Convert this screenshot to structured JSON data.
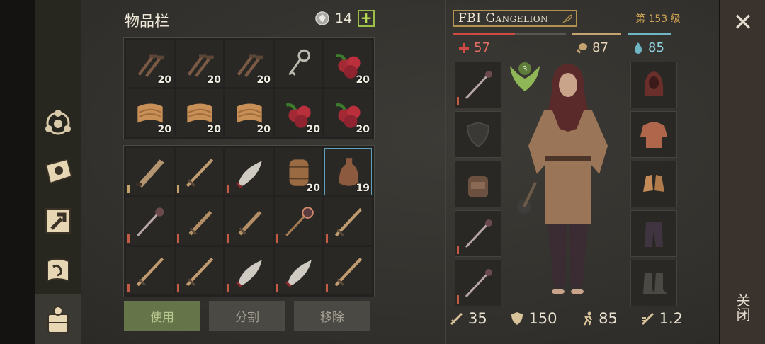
{
  "inventory": {
    "title": "物品栏",
    "currency_icon": "gem-coin-icon",
    "currency_count": "14",
    "add_label": "+",
    "top_slots": [
      {
        "icon": "rusty-nails-icon",
        "qty": "20"
      },
      {
        "icon": "rusty-nails-icon",
        "qty": "20"
      },
      {
        "icon": "rusty-nails-icon",
        "qty": "20"
      },
      {
        "icon": "key-icon",
        "qty": ""
      },
      {
        "icon": "berries-icon",
        "qty": "20"
      },
      {
        "icon": "cloth-scraps-icon",
        "qty": "20"
      },
      {
        "icon": "cloth-scraps-icon",
        "qty": "20"
      },
      {
        "icon": "cloth-scraps-icon",
        "qty": "20"
      },
      {
        "icon": "berries-icon",
        "qty": "20"
      },
      {
        "icon": "berries-icon",
        "qty": "20"
      }
    ],
    "bottom_slots": [
      {
        "icon": "cleaver-icon",
        "qty": ""
      },
      {
        "icon": "sword-icon",
        "qty": ""
      },
      {
        "icon": "scimitar-icon",
        "qty": ""
      },
      {
        "icon": "barrel-icon",
        "qty": "20"
      },
      {
        "icon": "flask-icon",
        "qty": "19"
      },
      {
        "icon": "mace-icon",
        "qty": ""
      },
      {
        "icon": "short-sword-icon",
        "qty": ""
      },
      {
        "icon": "short-sword-icon",
        "qty": ""
      },
      {
        "icon": "spiked-mace-icon",
        "qty": ""
      },
      {
        "icon": "sword-icon",
        "qty": ""
      },
      {
        "icon": "sword-icon",
        "qty": ""
      },
      {
        "icon": "sword-icon",
        "qty": ""
      },
      {
        "icon": "scimitar-icon",
        "qty": ""
      },
      {
        "icon": "scimitar-icon",
        "qty": ""
      },
      {
        "icon": "sword-icon",
        "qty": ""
      }
    ],
    "actions": {
      "use": "使用",
      "split": "分割",
      "remove": "移除"
    }
  },
  "character": {
    "name": "FBI Gangelion",
    "level": "第 153 级",
    "health": "57",
    "hunger": "87",
    "thirst": "85",
    "bars": {
      "health_fill": 0.55,
      "hunger_fill": 1.0,
      "thirst_fill": 1.0
    },
    "badge_level": "3",
    "left_equipment": [
      "mace-icon",
      "shield-placeholder-icon",
      "backpack-icon",
      "mace-icon",
      "mace-icon"
    ],
    "right_equipment": [
      "hood-icon",
      "padded-shirt-icon",
      "gloves-icon",
      "pants-icon",
      "boots-placeholder-icon"
    ],
    "stats": {
      "attack": "35",
      "armor": "150",
      "speed": "85",
      "attack_speed": "1.2"
    }
  },
  "close": {
    "x": "✕",
    "label": "关闭"
  },
  "colors": {
    "health": "#d04a45",
    "hunger": "#c5a370",
    "thirst": "#6fb6c4",
    "accent": "#b39251"
  }
}
